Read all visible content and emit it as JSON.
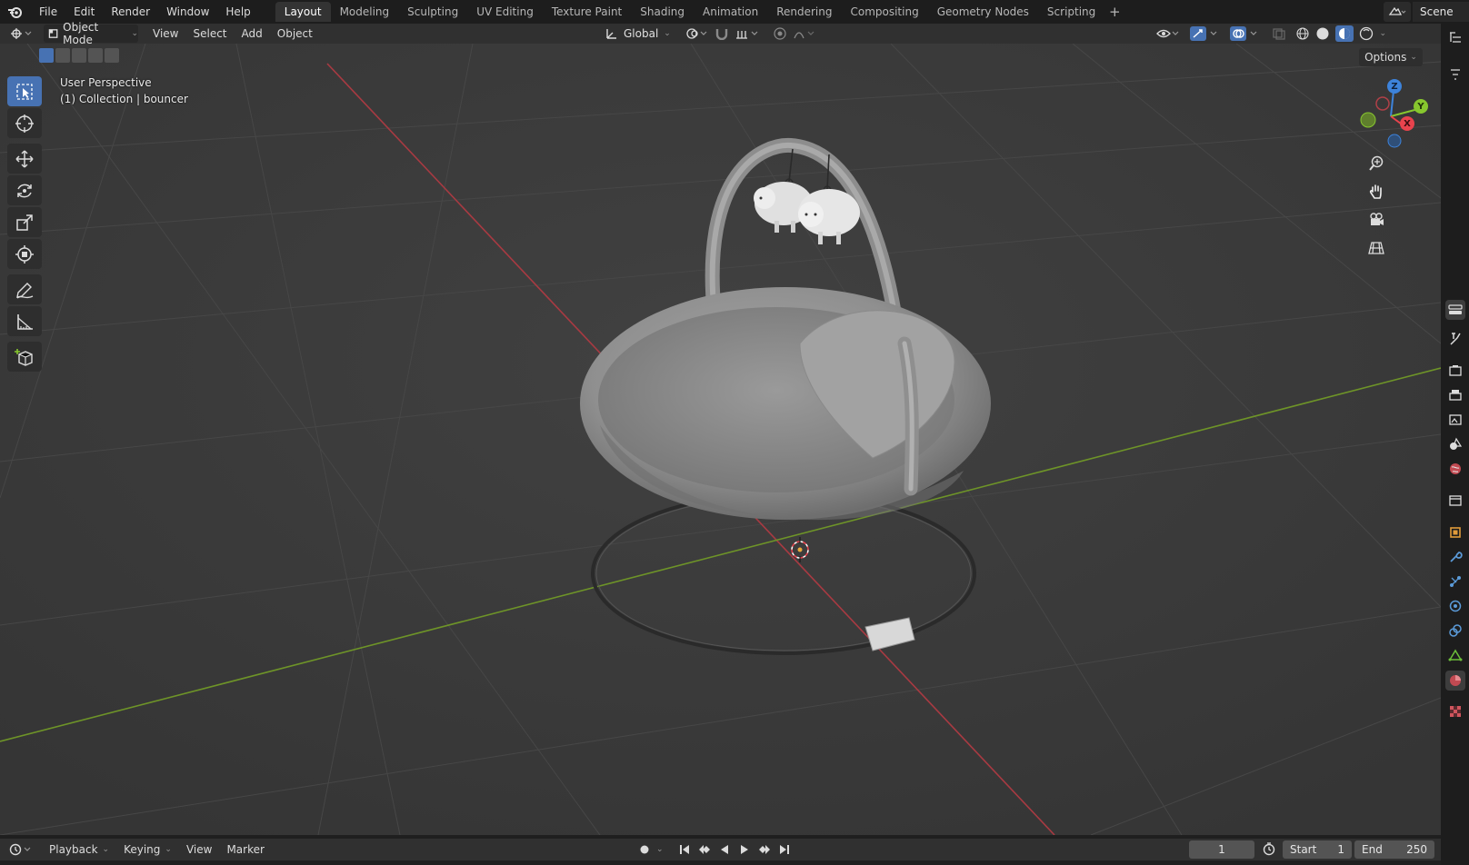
{
  "app": {
    "name": "Blender"
  },
  "menus": [
    "File",
    "Edit",
    "Render",
    "Window",
    "Help"
  ],
  "workspaces": {
    "tabs": [
      "Layout",
      "Modeling",
      "Sculpting",
      "UV Editing",
      "Texture Paint",
      "Shading",
      "Animation",
      "Rendering",
      "Compositing",
      "Geometry Nodes",
      "Scripting"
    ],
    "active": "Layout",
    "add_label": "+"
  },
  "scene": {
    "name": "Scene"
  },
  "viewport_header": {
    "mode": "Object Mode",
    "menus": [
      "View",
      "Select",
      "Add",
      "Object"
    ],
    "orientation": "Global",
    "options_label": "Options"
  },
  "viewport": {
    "perspective": "User Perspective",
    "collection_info": "(1) Collection | bouncer",
    "gizmo_axes": {
      "z": "Z",
      "y": "Y",
      "x": "X"
    }
  },
  "timeline": {
    "menus": [
      "Playback",
      "Keying",
      "View",
      "Marker"
    ],
    "current_frame": "1",
    "start_label": "Start",
    "start_value": "1",
    "end_label": "End",
    "end_value": "250"
  },
  "colors": {
    "accent": "#4772b3",
    "x_axis": "#e8434d",
    "y_axis": "#87c72e",
    "z_axis": "#3d83db",
    "viewport_bg": "#3c3c3c"
  }
}
